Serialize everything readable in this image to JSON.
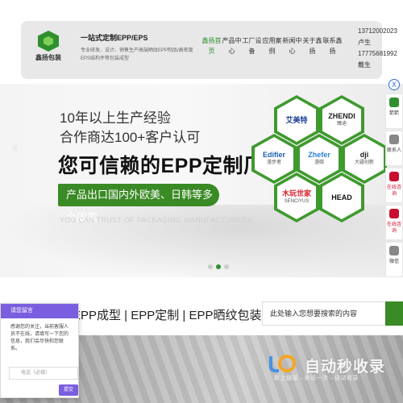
{
  "header": {
    "logo_text": "鑫扬包装",
    "company_title": "一站式定制EPP/EPS",
    "company_desc": "专业研发、设计、销售生产高端晒纹EPP制品/高密度EPS结构件等包装成型",
    "nav": [
      {
        "label": "鑫扬首页",
        "active": true
      },
      {
        "label": "产品中心",
        "active": false
      },
      {
        "label": "工厂设备",
        "active": false
      },
      {
        "label": "应用案例",
        "active": false
      },
      {
        "label": "新闻中心",
        "active": false
      },
      {
        "label": "关于鑫扬",
        "active": false
      },
      {
        "label": "联系鑫扬",
        "active": false
      }
    ],
    "phone1": "13712002023",
    "phone1_name": "卢生",
    "phone2": "17775681992",
    "phone2_name": "戴生"
  },
  "hero": {
    "line1": "10年以上生产经验",
    "line2": "合作商达100+客户认可",
    "title": "您可信赖的EPP定制厂家",
    "banner": "产品出口国内外欧美、日韩等多个国家",
    "english": "YOU CAN TRUST OF PACKAGING MANUFACTURERS",
    "prev_arrow": "‹",
    "brands": [
      {
        "name": "艾美特",
        "sub": "",
        "color": "#1d3f9a"
      },
      {
        "name": "ZHENDI",
        "sub": "臻迪",
        "color": "#222222"
      },
      {
        "name": "Edifier",
        "sub": "漫步者",
        "color": "#1d5fb0"
      },
      {
        "name": "Zhefer",
        "sub": "漫碳",
        "color": "#2a7fd0"
      },
      {
        "name": "dji",
        "sub": "大疆创新",
        "color": "#222222"
      },
      {
        "name": "木玩世家",
        "sub": "SENCIYUS",
        "color": "#d4202a"
      },
      {
        "name": "HEAD",
        "sub": "",
        "color": "#111111"
      }
    ]
  },
  "sidebar": {
    "close": "X",
    "items": [
      {
        "label": "箭箭",
        "color": "#2f8f2f"
      },
      {
        "label": "联系人",
        "color": "#888888"
      },
      {
        "label": "在线咨询",
        "color": "#c8102e"
      },
      {
        "label": "在线咨询",
        "color": "#c8102e"
      },
      {
        "label": "微信",
        "color": "#888888"
      }
    ]
  },
  "search": {
    "hot": "热门关键词：EPP成型 | EPP定制 | EPP晒纹包装",
    "placeholder": "此处输入您想要搜索的内容"
  },
  "chat": {
    "title": "请您留言",
    "body": "感谢您的关注，当前客服人员不在线，请填写一下您的信息，我们会尽快和您联系。",
    "input_placeholder": "电话（必填）",
    "send": "提交"
  },
  "watermark": {
    "text": "自动秒收录",
    "sub": "数上链接→来访一次→自动收录"
  }
}
